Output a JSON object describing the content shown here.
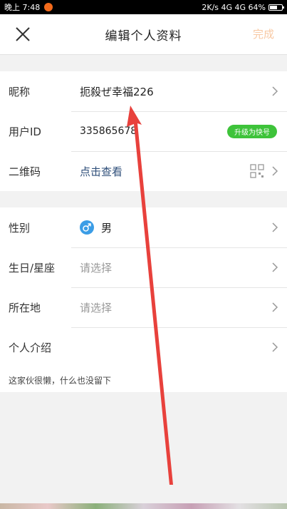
{
  "status_bar": {
    "left_text": "晚上 7:48",
    "right_text": "2K/s 4G 4G 64%",
    "battery_percent": 64
  },
  "header": {
    "title": "编辑个人资料",
    "done_label": "完成"
  },
  "profile": {
    "nickname_label": "昵称",
    "nickname_value": "扼殺ぜ幸福226",
    "user_id_label": "用户ID",
    "user_id_value": "335865678",
    "upgrade_badge": "升级为快号",
    "qrcode_label": "二维码",
    "qrcode_link": "点击查看"
  },
  "details": {
    "gender_label": "性别",
    "gender_value": "男",
    "birthday_label": "生日/星座",
    "birthday_placeholder": "请选择",
    "location_label": "所在地",
    "location_placeholder": "请选择",
    "intro_label": "个人介绍",
    "intro_text": "这家伙很懒，什么也没留下"
  },
  "colors": {
    "accent_done": "#f8c9a4",
    "badge_green": "#3ec33a",
    "gender_blue": "#3b9de6",
    "arrow_red": "#e8413c"
  }
}
